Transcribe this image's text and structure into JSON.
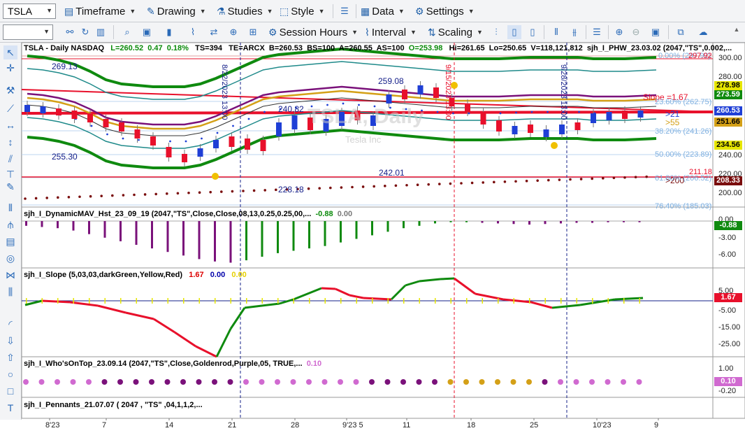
{
  "toolbar1": {
    "symbol": "TSLA",
    "timeframe": "Timeframe",
    "drawing": "Drawing",
    "studies": "Studies",
    "style": "Style",
    "data": "Data",
    "settings": "Settings"
  },
  "toolbar2": {
    "session_hours": "Session Hours",
    "interval": "Interval",
    "scaling": "Scaling"
  },
  "header": {
    "symbol": "TSLA - Daily  NASDAQ",
    "low": "L=260.52",
    "change": "0.47",
    "pct": "0.18%",
    "ts": "TS=394",
    "te": "TE=ARCX",
    "bid": "B=260.53",
    "bs": "BS=100",
    "ask": "A=260.55",
    "as": "AS=100",
    "open": "O=253.98",
    "high": "Hi=261.65",
    "lo": "Lo=250.65",
    "volume": "V=118,121,812",
    "study": "sjh_I_PHW_23.03.02 (2047,\"TS\",0.002,..."
  },
  "panels": {
    "p2_title": "sjh_I_DynamicMAV_Hst_23_09_19 (2047,\"TS\",Close,Close,08,13,0.25,0.25,00,...",
    "p2_v1": "-0.88",
    "p2_v2": "0.00",
    "p3_title": "sjh_I_Slope (5,03,03,darkGreen,Yellow,Red)",
    "p3_v1": "1.67",
    "p3_v2": "0.00",
    "p3_v3": "0.00",
    "p4_title": "sjh_I_Who'sOnTop_23.09.14 (2047,\"TS\",Close,Goldenrod,Purple,05,  TRUE,...",
    "p4_v1": "0.10",
    "p5_title": "sjh_I_Pennants_21.07.07 (  2047 ,  \"TS\" ,04,1,1,2,..."
  },
  "annotations": {
    "a1": "269.13",
    "a2": "255.30",
    "a3": "240.82",
    "a4": "259.08",
    "a5": "242.01",
    "a6": "228.18",
    "slope": "Slope =1.67",
    "gt21": ">21",
    "gt55": ">55",
    "gt200": ">200",
    "fib0": "0.00% (297.92)",
    "fib236": "23.60% (262.75)",
    "fib382": "38.20% (241.26)",
    "fib50": "50.00% (223.89)",
    "fib618": "61.80% (206.52)",
    "fib764": "76.40% (185.03)",
    "r1": "211.18",
    "r2": "297.92",
    "vl1": "8/22/2023 13:00",
    "vl2": "9/15/2023 13:00",
    "vl3": "9/28/2023 13:00",
    "watermark": "TSLA, Daily",
    "watermark2": "Tesla Inc"
  },
  "price_axis": [
    "300.00",
    "280.00",
    "260.00",
    "240.00",
    "220.00",
    "200.00"
  ],
  "price_badges": {
    "b1": "278.98",
    "b2": "273.59",
    "b3": "260.53",
    "b4": "251.66",
    "b5": "234.56",
    "b6": "208.33"
  },
  "osc_axis": {
    "p2": [
      "0.00",
      "-3.00",
      "-6.00"
    ],
    "p2_badge": "-0.88",
    "p3": [
      "5.00",
      "-5.00",
      "-15.00",
      "-25.00"
    ],
    "p3_badge": "1.67",
    "p4": [
      "1.00",
      "-0.20"
    ],
    "p4_badge": "0.10"
  },
  "time_axis": [
    "8'23",
    "7",
    "14",
    "21",
    "28",
    "9'23  5",
    "11",
    "18",
    "25",
    "10'23",
    "9"
  ],
  "colors": {
    "up": "#1f3fd6",
    "down": "#e8102b",
    "green": "#0f8a0f",
    "purple": "#7a117a",
    "gold": "#d4a017",
    "teal": "#1f8a8a",
    "accent": "#1f5fa8"
  }
}
